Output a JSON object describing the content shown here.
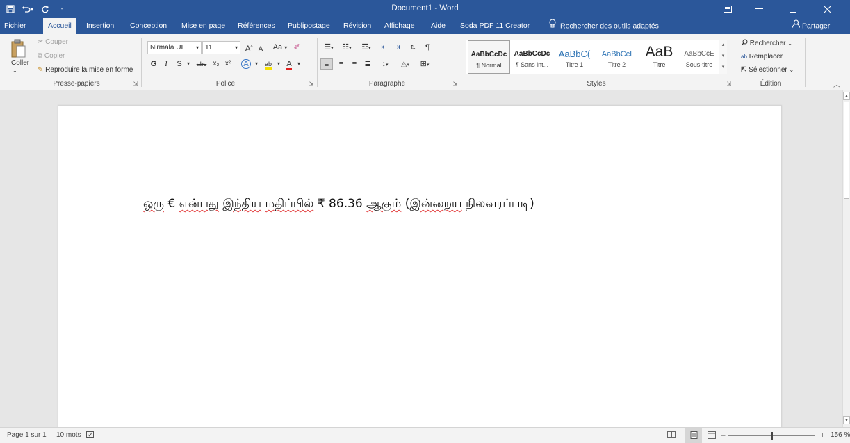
{
  "titlebar": {
    "title": "Document1 - Word",
    "save_icon": "save-icon",
    "undo_icon": "undo-icon",
    "redo_icon": "redo-icon"
  },
  "menu": {
    "tabs": [
      {
        "label": "Fichier"
      },
      {
        "label": "Accueil",
        "active": true
      },
      {
        "label": "Insertion"
      },
      {
        "label": "Conception"
      },
      {
        "label": "Mise en page"
      },
      {
        "label": "Références"
      },
      {
        "label": "Publipostage"
      },
      {
        "label": "Révision"
      },
      {
        "label": "Affichage"
      },
      {
        "label": "Aide"
      },
      {
        "label": "Soda PDF 11 Creator"
      }
    ],
    "tell_me": "Rechercher des outils adaptés",
    "share": "Partager"
  },
  "ribbon": {
    "clipboard": {
      "paste": "Coller",
      "cut": "Couper",
      "copy": "Copier",
      "format_painter": "Reproduire la mise en forme",
      "label": "Presse-papiers"
    },
    "font": {
      "family": "Nirmala UI",
      "size": "11",
      "grow": "A",
      "shrink": "A",
      "change_case": "Aa",
      "bold": "G",
      "italic": "I",
      "underline": "S",
      "strikethrough": "abc",
      "subscript": "x₂",
      "superscript": "x²",
      "text_effects": "A",
      "highlight": "ab",
      "font_color": "A",
      "label": "Police"
    },
    "paragraph": {
      "label": "Paragraphe"
    },
    "styles": {
      "items": [
        {
          "preview": "AaBbCcDc",
          "name": "¶ Normal",
          "selected": true
        },
        {
          "preview": "AaBbCcDc",
          "name": "¶ Sans int..."
        },
        {
          "preview": "AaBbC(",
          "name": "Titre 1"
        },
        {
          "preview": "AaBbCcI",
          "name": "Titre 2"
        },
        {
          "preview": "AaB",
          "name": "Titre"
        },
        {
          "preview": "AaBbCcE",
          "name": "Sous-titre"
        }
      ],
      "label": "Styles"
    },
    "editing": {
      "find": "Rechercher",
      "replace": "Remplacer",
      "select": "Sélectionner",
      "label": "Édition"
    }
  },
  "document": {
    "segments": [
      {
        "text": "ஒரு",
        "sq": true
      },
      {
        "text": " € ",
        "sq": false
      },
      {
        "text": "என்பது",
        "sq": true
      },
      {
        "text": " ",
        "sq": false
      },
      {
        "text": "இந்திய",
        "sq": true
      },
      {
        "text": " ",
        "sq": false
      },
      {
        "text": "மதிப்பில்",
        "sq": true
      },
      {
        "text": " ₹ 86.36 ",
        "sq": false
      },
      {
        "text": "ஆகும்",
        "sq": true
      },
      {
        "text": " (",
        "sq": false
      },
      {
        "text": "இன்றைய",
        "sq": true
      },
      {
        "text": " நிலவரப்படி)",
        "sq": false
      }
    ]
  },
  "status": {
    "page": "Page 1 sur 1",
    "words": "10 mots",
    "zoom": "156 %",
    "zoom_fraction": 0.5
  }
}
